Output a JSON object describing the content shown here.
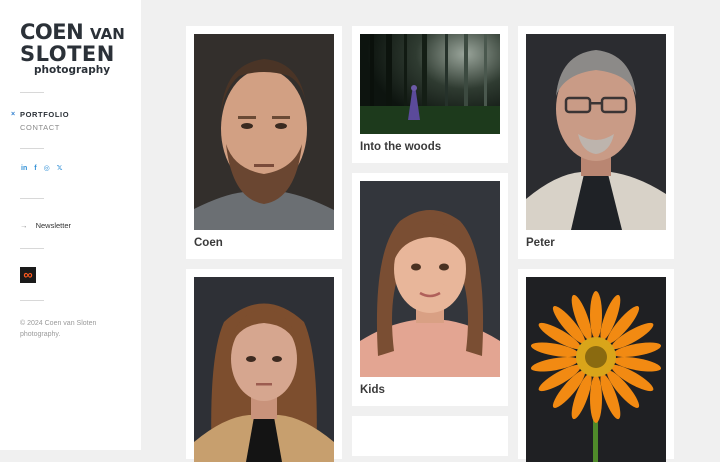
{
  "brand": {
    "line1_word1": "COEN",
    "line1_word2": "VAN",
    "line2": "SLOTEN",
    "line3": "photography"
  },
  "nav": {
    "items": [
      {
        "label": "PORTFOLIO",
        "active": true
      },
      {
        "label": "CONTACT",
        "active": false
      }
    ],
    "active_marker": "×"
  },
  "social": {
    "icons": [
      "linkedin-icon",
      "facebook-icon",
      "instagram-icon",
      "x-twitter-icon"
    ],
    "glyphs": [
      "in",
      "f",
      "◎",
      "𝕏"
    ]
  },
  "newsletter": {
    "arrow": "→",
    "label": "Newsletter"
  },
  "badge": {
    "glyph": "∞",
    "color": "#ff5a1f"
  },
  "footer": {
    "copyright": "© 2024 Coen van Sloten photography."
  },
  "gallery": {
    "cards": [
      {
        "caption": "Coen",
        "image": "portrait of bearded man"
      },
      {
        "caption": "Into the woods",
        "image": "dark forest with hooded figure"
      },
      {
        "caption": "Peter",
        "image": "portrait of older man with glasses"
      },
      {
        "caption": "Kids",
        "image": "portrait of young girl"
      },
      {
        "caption": "",
        "image": "portrait of woman with curly hair"
      },
      {
        "caption": "",
        "image": "orange gerbera flower"
      },
      {
        "caption": "",
        "image": ""
      }
    ]
  },
  "colors": {
    "accent": "#2f8fd6",
    "text_dark": "#2b3138",
    "background": "#f0f0f0",
    "card": "#ffffff"
  }
}
